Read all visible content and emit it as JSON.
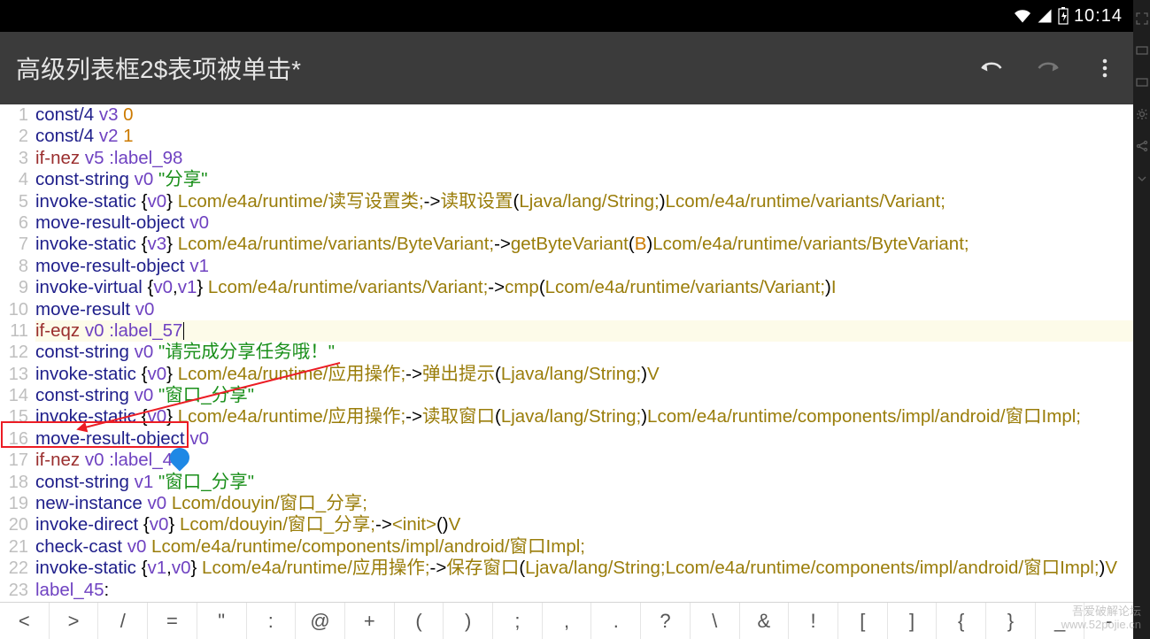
{
  "statusbar": {
    "time": "10:14"
  },
  "appbar": {
    "title": "高级列表框2$表项被单击*"
  },
  "editor": {
    "highlight_line": 11,
    "lines": [
      {
        "n": 1,
        "tokens": [
          [
            "op",
            "const/4"
          ],
          [
            "brk",
            " "
          ],
          [
            "reg",
            "v3"
          ],
          [
            "brk",
            " "
          ],
          [
            "num",
            "0"
          ]
        ]
      },
      {
        "n": 2,
        "tokens": [
          [
            "op",
            "const/4"
          ],
          [
            "brk",
            " "
          ],
          [
            "reg",
            "v2"
          ],
          [
            "brk",
            " "
          ],
          [
            "num",
            "1"
          ]
        ]
      },
      {
        "n": 3,
        "tokens": [
          [
            "kw",
            "if-nez"
          ],
          [
            "brk",
            " "
          ],
          [
            "reg",
            "v5"
          ],
          [
            "brk",
            " "
          ],
          [
            "lbl",
            ":label_98"
          ]
        ]
      },
      {
        "n": 4,
        "tokens": [
          [
            "op",
            "const-string"
          ],
          [
            "brk",
            " "
          ],
          [
            "reg",
            "v0"
          ],
          [
            "brk",
            " "
          ],
          [
            "str",
            "\"分享\""
          ]
        ]
      },
      {
        "n": 5,
        "tokens": [
          [
            "op",
            "invoke-static"
          ],
          [
            "brk",
            " {"
          ],
          [
            "reg",
            "v0"
          ],
          [
            "brk",
            "} "
          ],
          [
            "cls",
            "Lcom/e4a/runtime/读写设置类;"
          ],
          [
            "brk",
            "->"
          ],
          [
            "cls",
            "读取设置"
          ],
          [
            "brk",
            "("
          ],
          [
            "cls",
            "Ljava/lang/String;"
          ],
          [
            "brk",
            ")"
          ],
          [
            "cls",
            "Lcom/e4a/runtime/variants/Variant;"
          ]
        ]
      },
      {
        "n": 6,
        "tokens": [
          [
            "op",
            "move-result-object"
          ],
          [
            "brk",
            " "
          ],
          [
            "reg",
            "v0"
          ]
        ]
      },
      {
        "n": 7,
        "tokens": [
          [
            "op",
            "invoke-static"
          ],
          [
            "brk",
            " {"
          ],
          [
            "reg",
            "v3"
          ],
          [
            "brk",
            "} "
          ],
          [
            "cls",
            "Lcom/e4a/runtime/variants/ByteVariant;"
          ],
          [
            "brk",
            "->"
          ],
          [
            "cls",
            "getByteVariant"
          ],
          [
            "brk",
            "("
          ],
          [
            "num",
            "B"
          ],
          [
            "brk",
            ")"
          ],
          [
            "cls",
            "Lcom/e4a/runtime/variants/ByteVariant;"
          ]
        ]
      },
      {
        "n": 8,
        "tokens": [
          [
            "op",
            "move-result-object"
          ],
          [
            "brk",
            " "
          ],
          [
            "reg",
            "v1"
          ]
        ]
      },
      {
        "n": 9,
        "tokens": [
          [
            "op",
            "invoke-virtual"
          ],
          [
            "brk",
            " {"
          ],
          [
            "reg",
            "v0"
          ],
          [
            "brk",
            ","
          ],
          [
            "reg",
            "v1"
          ],
          [
            "brk",
            "} "
          ],
          [
            "cls",
            "Lcom/e4a/runtime/variants/Variant;"
          ],
          [
            "brk",
            "->"
          ],
          [
            "cls",
            "cmp"
          ],
          [
            "brk",
            "("
          ],
          [
            "cls",
            "Lcom/e4a/runtime/variants/Variant;"
          ],
          [
            "brk",
            ")"
          ],
          [
            "cls",
            "I"
          ]
        ]
      },
      {
        "n": 10,
        "tokens": [
          [
            "op",
            "move-result"
          ],
          [
            "brk",
            " "
          ],
          [
            "reg",
            "v0"
          ]
        ]
      },
      {
        "n": 11,
        "tokens": [
          [
            "kw",
            "if-eqz"
          ],
          [
            "brk",
            " "
          ],
          [
            "reg",
            "v0"
          ],
          [
            "brk",
            " "
          ],
          [
            "lbl",
            ":label_57"
          ]
        ]
      },
      {
        "n": 12,
        "tokens": [
          [
            "op",
            "const-string"
          ],
          [
            "brk",
            " "
          ],
          [
            "reg",
            "v0"
          ],
          [
            "brk",
            " "
          ],
          [
            "str",
            "\"请完成分享任务哦！\""
          ]
        ]
      },
      {
        "n": 13,
        "tokens": [
          [
            "op",
            "invoke-static"
          ],
          [
            "brk",
            " {"
          ],
          [
            "reg",
            "v0"
          ],
          [
            "brk",
            "} "
          ],
          [
            "cls",
            "Lcom/e4a/runtime/应用操作;"
          ],
          [
            "brk",
            "->"
          ],
          [
            "cls",
            "弹出提示"
          ],
          [
            "brk",
            "("
          ],
          [
            "cls",
            "Ljava/lang/String;"
          ],
          [
            "brk",
            ")"
          ],
          [
            "cls",
            "V"
          ]
        ]
      },
      {
        "n": 14,
        "tokens": [
          [
            "op",
            "const-string"
          ],
          [
            "brk",
            " "
          ],
          [
            "reg",
            "v0"
          ],
          [
            "brk",
            " "
          ],
          [
            "str",
            "\"窗口_分享\""
          ]
        ]
      },
      {
        "n": 15,
        "tokens": [
          [
            "op",
            "invoke-static"
          ],
          [
            "brk",
            " {"
          ],
          [
            "reg",
            "v0"
          ],
          [
            "brk",
            "} "
          ],
          [
            "cls",
            "Lcom/e4a/runtime/应用操作;"
          ],
          [
            "brk",
            "->"
          ],
          [
            "cls",
            "读取窗口"
          ],
          [
            "brk",
            "("
          ],
          [
            "cls",
            "Ljava/lang/String;"
          ],
          [
            "brk",
            ")"
          ],
          [
            "cls",
            "Lcom/e4a/runtime/components/impl/android/窗口Impl;"
          ]
        ]
      },
      {
        "n": 16,
        "tokens": [
          [
            "op",
            "move-result-object"
          ],
          [
            "brk",
            " "
          ],
          [
            "reg",
            "v0"
          ]
        ]
      },
      {
        "n": 17,
        "tokens": [
          [
            "kw",
            "if-nez"
          ],
          [
            "brk",
            " "
          ],
          [
            "reg",
            "v0"
          ],
          [
            "brk",
            " "
          ],
          [
            "lbl",
            ":label_45"
          ]
        ]
      },
      {
        "n": 18,
        "tokens": [
          [
            "op",
            "const-string"
          ],
          [
            "brk",
            " "
          ],
          [
            "reg",
            "v1"
          ],
          [
            "brk",
            " "
          ],
          [
            "str",
            "\"窗口_分享\""
          ]
        ]
      },
      {
        "n": 19,
        "tokens": [
          [
            "op",
            "new-instance"
          ],
          [
            "brk",
            " "
          ],
          [
            "reg",
            "v0"
          ],
          [
            "brk",
            " "
          ],
          [
            "cls",
            "Lcom/douyin/窗口_分享;"
          ]
        ]
      },
      {
        "n": 20,
        "tokens": [
          [
            "op",
            "invoke-direct"
          ],
          [
            "brk",
            " {"
          ],
          [
            "reg",
            "v0"
          ],
          [
            "brk",
            "} "
          ],
          [
            "cls",
            "Lcom/douyin/窗口_分享;"
          ],
          [
            "brk",
            "->"
          ],
          [
            "cls",
            "<init>"
          ],
          [
            "brk",
            "()"
          ],
          [
            "cls",
            "V"
          ]
        ]
      },
      {
        "n": 21,
        "tokens": [
          [
            "op",
            "check-cast"
          ],
          [
            "brk",
            " "
          ],
          [
            "reg",
            "v0"
          ],
          [
            "brk",
            " "
          ],
          [
            "cls",
            "Lcom/e4a/runtime/components/impl/android/窗口Impl;"
          ]
        ]
      },
      {
        "n": 22,
        "tokens": [
          [
            "op",
            "invoke-static"
          ],
          [
            "brk",
            " {"
          ],
          [
            "reg",
            "v1"
          ],
          [
            "brk",
            ","
          ],
          [
            "reg",
            "v0"
          ],
          [
            "brk",
            "} "
          ],
          [
            "cls",
            "Lcom/e4a/runtime/应用操作;"
          ],
          [
            "brk",
            "->"
          ],
          [
            "cls",
            "保存窗口"
          ],
          [
            "brk",
            "("
          ],
          [
            "cls",
            "Ljava/lang/String;"
          ],
          [
            "cls",
            "Lcom/e4a/runtime/components/impl/android/窗口Impl;"
          ],
          [
            "brk",
            ")"
          ],
          [
            "cls",
            "V"
          ]
        ]
      },
      {
        "n": 23,
        "tokens": [
          [
            "lbl",
            "label_45"
          ],
          [
            "brk",
            ":"
          ]
        ]
      }
    ]
  },
  "symbols": [
    "<",
    ">",
    "/",
    "=",
    "\"",
    ":",
    "@",
    "+",
    "(",
    ")",
    ";",
    ",",
    ".",
    "?",
    "\\",
    "&",
    "!",
    "[",
    "]",
    "{",
    "}",
    "_",
    "-"
  ],
  "watermark": {
    "l1": "吾爱破解论坛",
    "l2": "www.52pojie.cn"
  }
}
